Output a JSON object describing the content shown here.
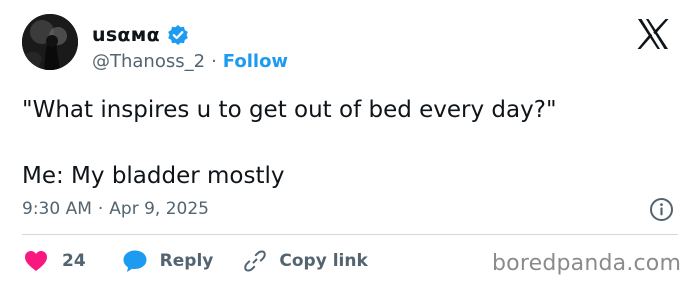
{
  "author": {
    "display_name": "usαмα",
    "handle": "@Thanoss_2",
    "separator": "·",
    "follow_label": "Follow",
    "verified": true
  },
  "icons": {
    "verified": "verified-badge-icon",
    "brand": "x-logo-icon",
    "info": "info-icon",
    "like": "heart-icon",
    "reply": "speech-bubble-icon",
    "copy": "link-icon"
  },
  "tweet": {
    "line1": "\"What inspires u to get out of bed every day?\"",
    "line2": "Me: My bladder mostly"
  },
  "meta": {
    "time": "9:30 AM",
    "separator": "·",
    "date": "Apr 9, 2025"
  },
  "actions": {
    "like_count": "24",
    "reply_label": "Reply",
    "copy_label": "Copy link"
  },
  "watermark": "boredpanda.com",
  "colors": {
    "accent": "#1d9bf0",
    "like": "#f91880",
    "secondary_text": "#536471",
    "divider": "#cfd9de"
  }
}
